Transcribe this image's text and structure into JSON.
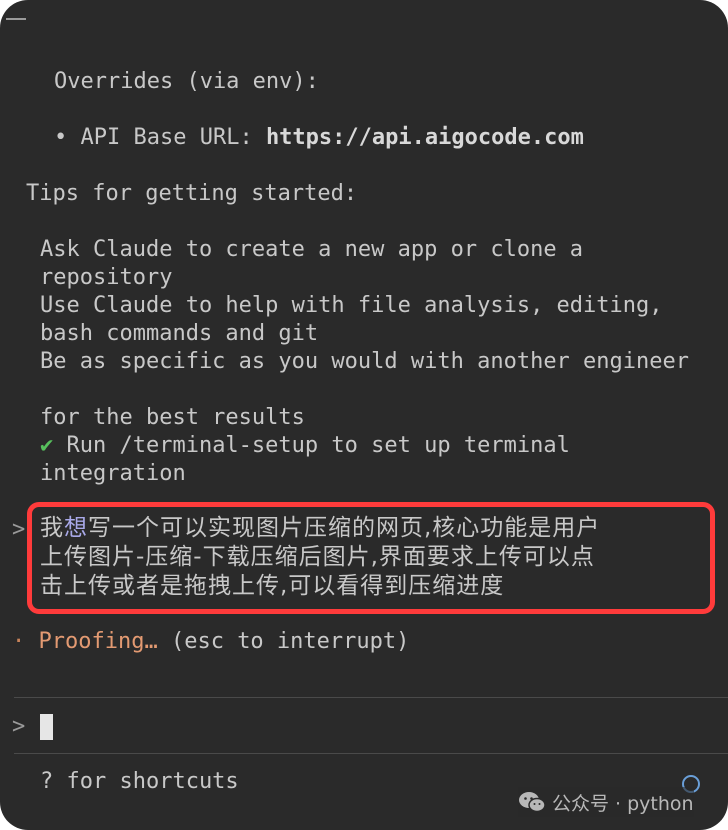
{
  "terminal": {
    "overrides_heading": "Overrides (via env):",
    "api_base": {
      "bullet": "•",
      "label": "API Base URL: ",
      "value": "https://api.aigocode.com"
    },
    "tips_heading": "Tips for getting started:",
    "tips": [
      "Ask Claude to create a new app or clone a",
      "repository",
      "Use Claude to help with file analysis, editing,",
      "bash commands and git",
      "Be as specific as you would with another engineer",
      "for the best results"
    ],
    "setup": {
      "check": "✔",
      "text": " Run /terminal-setup to set up terminal",
      "text_cont": "integration"
    },
    "user_message": {
      "caret": ">",
      "line1_pre": "我",
      "line1_hl": "想",
      "line1_post": "写一个可以实现图片压缩的网页,核心功能是用户",
      "line2": "上传图片-压缩-下载压缩后图片,界面要求上传可以点",
      "line3": "击上传或者是拖拽上传,可以看得到压缩进度"
    },
    "status": {
      "dot": "·",
      "word": "Proofing…",
      "hint": " (esc to interrupt)"
    },
    "input": {
      "caret": ">"
    },
    "shortcuts_hint": "? for shortcuts"
  },
  "watermark": {
    "text": "公众号 · python"
  },
  "colors": {
    "background": "#2a2a2a",
    "text": "#c8c8c8",
    "highlight_border": "#ff3b3b",
    "check": "#57c05d",
    "proofing": "#e39a72"
  }
}
